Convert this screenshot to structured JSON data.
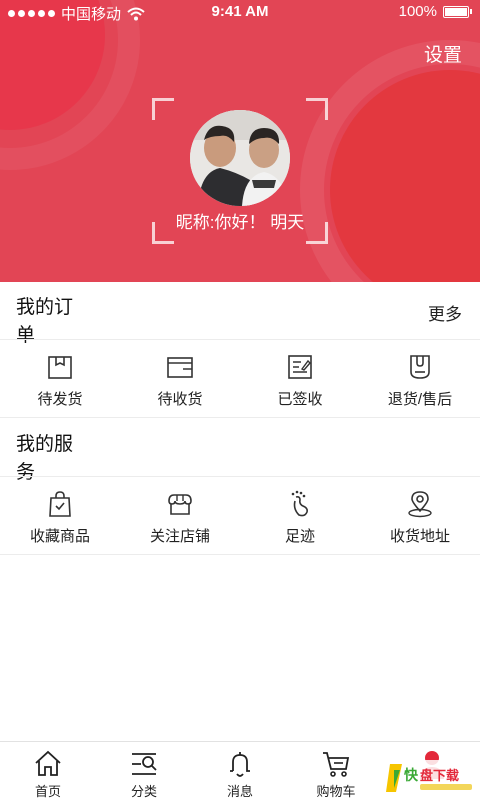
{
  "status_bar": {
    "carrier": "中国移动",
    "time": "9:41 AM",
    "battery": "100%"
  },
  "header": {
    "settings_label": "设置",
    "nickname": "昵称:你好！ 明天",
    "colors": {
      "background": "#e24555",
      "accent": "#e3383f"
    }
  },
  "orders": {
    "title": "我的订单",
    "more_label": "更多",
    "items": [
      {
        "label": "待发货",
        "icon": "package-icon"
      },
      {
        "label": "待收货",
        "icon": "card-box-icon"
      },
      {
        "label": "已签收",
        "icon": "signed-doc-icon"
      },
      {
        "label": "退货/售后",
        "icon": "return-bag-icon"
      }
    ]
  },
  "services": {
    "title": "我的服务",
    "items": [
      {
        "label": "收藏商品",
        "icon": "favorite-bag-icon"
      },
      {
        "label": "关注店铺",
        "icon": "store-icon"
      },
      {
        "label": "足迹",
        "icon": "footprint-icon"
      },
      {
        "label": "收货地址",
        "icon": "location-pin-icon"
      }
    ]
  },
  "tabbar": {
    "items": [
      {
        "label": "首页",
        "icon": "home-icon"
      },
      {
        "label": "分类",
        "icon": "category-search-icon"
      },
      {
        "label": "消息",
        "icon": "bell-icon"
      },
      {
        "label": "购物车",
        "icon": "cart-icon"
      },
      {
        "label": "",
        "icon": "user-icon"
      }
    ]
  },
  "watermark": {
    "text": "快盘下载"
  }
}
